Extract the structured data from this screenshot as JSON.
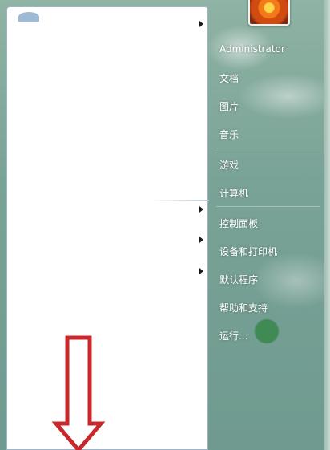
{
  "start_menu": {
    "user_name": "Administrator",
    "items": [
      {
        "label": "Administrator"
      },
      {
        "label": "文档"
      },
      {
        "label": "图片"
      },
      {
        "label": "音乐"
      },
      {
        "label": "游戏"
      },
      {
        "label": "计算机"
      },
      {
        "label": "控制面板"
      },
      {
        "label": "设备和打印机"
      },
      {
        "label": "默认程序"
      },
      {
        "label": "帮助和支持"
      },
      {
        "label": "运行..."
      }
    ]
  },
  "colors": {
    "accent_arrow": "#c8282c",
    "menu_text": "#ffffff"
  }
}
